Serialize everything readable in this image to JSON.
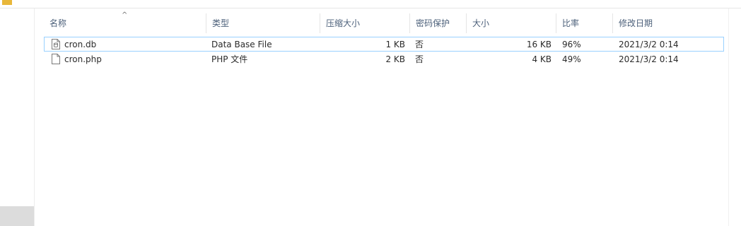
{
  "columns": {
    "name": "名称",
    "type": "类型",
    "compressed_size": "压缩大小",
    "password_protected": "密码保护",
    "size": "大小",
    "ratio": "比率",
    "modified": "修改日期"
  },
  "sort": {
    "column": "name",
    "direction": "ascending"
  },
  "files": [
    {
      "name": "cron.db",
      "type": "Data Base File",
      "compressed_size": "1 KB",
      "password_protected": "否",
      "size": "16 KB",
      "ratio": "96%",
      "modified": "2021/3/2 0:14",
      "icon": "database-file-icon",
      "selected": true
    },
    {
      "name": "cron.php",
      "type": "PHP 文件",
      "compressed_size": "2 KB",
      "password_protected": "否",
      "size": "4 KB",
      "ratio": "49%",
      "modified": "2021/3/2 0:14",
      "icon": "generic-file-icon",
      "selected": false
    }
  ],
  "colors": {
    "header_text": "#4c607a",
    "selection_border": "#99d1ff",
    "nav_scroll_block": "#dcdcdc"
  }
}
